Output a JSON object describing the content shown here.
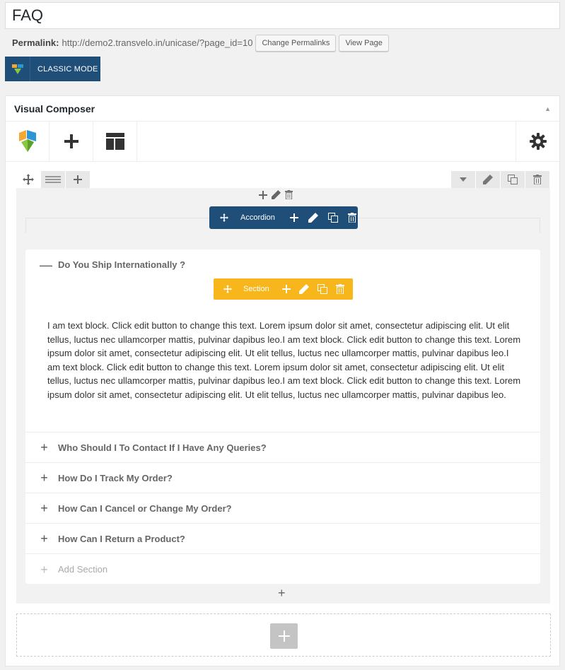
{
  "post": {
    "title": "FAQ",
    "permalink_label": "Permalink:",
    "permalink_url": "http://demo2.transvelo.in/unicase/?page_id=10",
    "change_permalinks": "Change Permalinks",
    "view_page": "View Page",
    "classic_mode": "CLASSIC MODE"
  },
  "composer": {
    "title": "Visual Composer",
    "toolbar_icons": [
      "vc-logo-icon",
      "add-element-icon",
      "templates-icon",
      "settings-gear-icon"
    ]
  },
  "accordion": {
    "label": "Accordion",
    "section_label": "Section",
    "sections": [
      {
        "title": "Do You Ship Internationally ?",
        "open": true
      },
      {
        "title": "Who Should I To Contact If I Have Any Queries?",
        "open": false
      },
      {
        "title": "How Do I Track My Order?",
        "open": false
      },
      {
        "title": "How Can I Cancel or Change My Order?",
        "open": false
      },
      {
        "title": "How Can I Return a Product?",
        "open": false
      }
    ],
    "text_block": "I am text block. Click edit button to change this text. Lorem ipsum dolor sit amet, consectetur adipiscing elit. Ut elit tellus, luctus nec ullamcorper mattis, pulvinar dapibus leo.I am text block. Click edit button to change this text. Lorem ipsum dolor sit amet, consectetur adipiscing elit. Ut elit tellus, luctus nec ullamcorper mattis, pulvinar dapibus leo.I am text block. Click edit button to change this text. Lorem ipsum dolor sit amet, consectetur adipiscing elit. Ut elit tellus, luctus nec ullamcorper mattis, pulvinar dapibus leo.I am text block. Click edit button to change this text. Lorem ipsum dolor sit amet, consectetur adipiscing elit. Ut elit tellus, luctus nec ullamcorper mattis, pulvinar dapibus leo.",
    "add_section": "Add Section"
  },
  "colors": {
    "accordion_bar": "#1f4e79",
    "section_bar": "#f6b61c",
    "logo_orange": "#f3a833",
    "logo_blue": "#2b96d3",
    "logo_green": "#8cc53f"
  }
}
